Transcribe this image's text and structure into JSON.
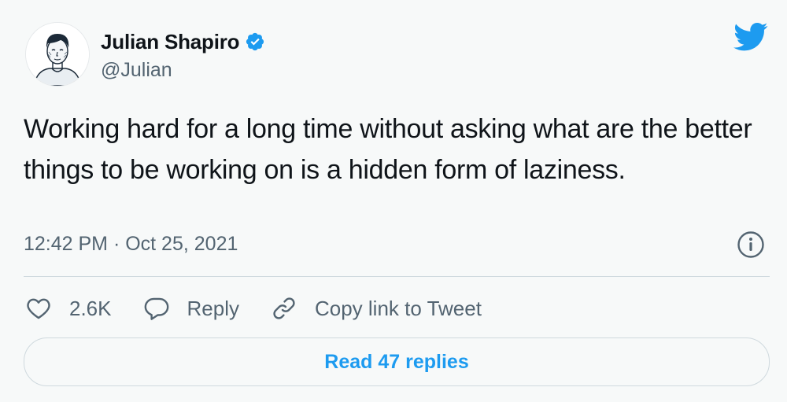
{
  "tweet": {
    "author": {
      "name": "Julian Shapiro",
      "handle": "@Julian",
      "verified": true
    },
    "text": "Working hard for a long time without asking what are the better things to be working on is a hidden form of laziness.",
    "timestamp": "12:42 PM · Oct 25, 2021"
  },
  "actions": {
    "like_count": "2.6K",
    "reply_label": "Reply",
    "copy_link_label": "Copy link to Tweet"
  },
  "footer": {
    "read_replies_label": "Read 47 replies"
  },
  "icons": {
    "verified": "verified-badge-icon",
    "brand": "twitter-bird-icon",
    "info": "info-icon",
    "like": "heart-icon",
    "reply": "speech-bubble-icon",
    "copy_link": "link-icon"
  },
  "colors": {
    "accent": "#1d9bf0",
    "text_primary": "#0f1419",
    "text_secondary": "#536471",
    "border": "#cfd9de",
    "background": "#f7f9f9"
  }
}
